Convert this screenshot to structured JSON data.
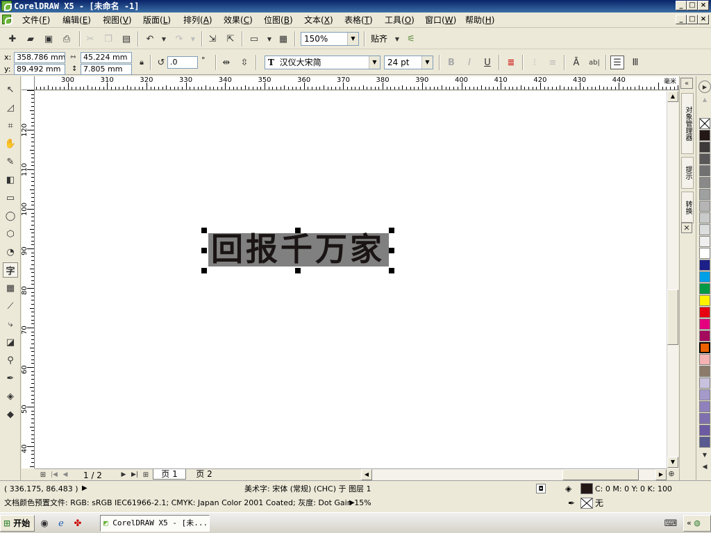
{
  "window": {
    "title": "CorelDRAW X5 - [未命名 -1]",
    "controls": [
      "_",
      "□",
      "×"
    ]
  },
  "menu": [
    {
      "label": "文件",
      "key": "F"
    },
    {
      "label": "编辑",
      "key": "E"
    },
    {
      "label": "视图",
      "key": "V"
    },
    {
      "label": "版面",
      "key": "L"
    },
    {
      "label": "排列",
      "key": "A"
    },
    {
      "label": "效果",
      "key": "C"
    },
    {
      "label": "位图",
      "key": "B"
    },
    {
      "label": "文本",
      "key": "X"
    },
    {
      "label": "表格",
      "key": "T"
    },
    {
      "label": "工具",
      "key": "O"
    },
    {
      "label": "窗口",
      "key": "W"
    },
    {
      "label": "帮助",
      "key": "H"
    }
  ],
  "toolbar": {
    "zoom": "150%",
    "snap": "贴齐"
  },
  "property_bar": {
    "x": "358.786 mm",
    "y": "89.492 mm",
    "width": "45.224 mm",
    "height": "7.805 mm",
    "rotation": ".0",
    "degree_symbol": "°",
    "font": "汉仪大宋简",
    "font_size": "24 pt",
    "x_label": "x:",
    "y_label": "y:"
  },
  "rulers": {
    "unit": "毫米",
    "h_ticks": [
      "300",
      "310",
      "320",
      "330",
      "340",
      "350",
      "360",
      "370",
      "380",
      "390",
      "400",
      "410",
      "420",
      "430",
      "440"
    ],
    "v_ticks": [
      "120",
      "110",
      "100",
      "90",
      "80",
      "70",
      "60",
      "50",
      "40"
    ]
  },
  "canvas": {
    "text": "回报千万家"
  },
  "page_nav": {
    "counter": "1 / 2",
    "pages": [
      "页 1",
      "页 2"
    ]
  },
  "dockers": [
    "对象管理器",
    "提示",
    "转换"
  ],
  "palette": {
    "colors": [
      "#231815",
      "#3e3a39",
      "#595757",
      "#727171",
      "#898989",
      "#9fa0a0",
      "#b5b5b6",
      "#c9caca",
      "#dcdddd",
      "#efefef",
      "#ffffff",
      "#1d2088",
      "#00a0e9",
      "#009944",
      "#fff100",
      "#e60012",
      "#e4007f",
      "#a40b5d",
      "#eb6100",
      "#f5b2b2",
      "#8c7b6b",
      "#c8c2de",
      "#a59aca",
      "#8f82bc",
      "#7f6fae",
      "#6c5ba3",
      "#595a8f"
    ]
  },
  "status": {
    "coords": "( 336.175, 86.483 )",
    "object_info": "美术字: 宋体 (常规) (CHC) 于 图层 1",
    "fill": "C: 0 M: 0 Y: 0 K: 100",
    "outline": "无",
    "profile": "文档颜色预置文件: RGB: sRGB IEC61966-2.1; CMYK: Japan Color 2001 Coated; 灰度: Dot Gain 15%"
  },
  "taskbar": {
    "start": "开始",
    "app": "CorelDRAW X5 - [未..."
  }
}
